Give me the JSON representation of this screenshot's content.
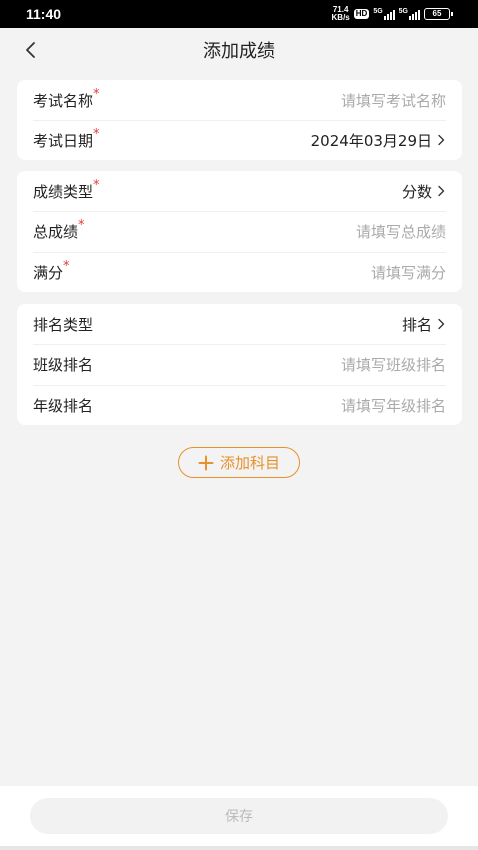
{
  "status": {
    "time": "11:40",
    "net_speed_value": "71.4",
    "net_speed_unit": "KB/s",
    "hd": "HD",
    "sim1": "5G",
    "sim2": "5G",
    "battery": "65"
  },
  "nav": {
    "title": "添加成绩"
  },
  "exam": {
    "name_label": "考试名称",
    "name_placeholder": "请填写考试名称",
    "date_label": "考试日期",
    "date_value": "2024年03月29日"
  },
  "score": {
    "type_label": "成绩类型",
    "type_value": "分数",
    "total_label": "总成绩",
    "total_placeholder": "请填写总成绩",
    "full_label": "满分",
    "full_placeholder": "请填写满分"
  },
  "rank": {
    "type_label": "排名类型",
    "type_value": "排名",
    "class_label": "班级排名",
    "class_placeholder": "请填写班级排名",
    "grade_label": "年级排名",
    "grade_placeholder": "请填写年级排名"
  },
  "required_mark": "*",
  "add_subject_label": "添加科目",
  "save_label": "保存",
  "colors": {
    "accent": "#e8912a",
    "required": "#e53935",
    "placeholder": "#aaaaaa",
    "background": "#f3f3f3"
  }
}
